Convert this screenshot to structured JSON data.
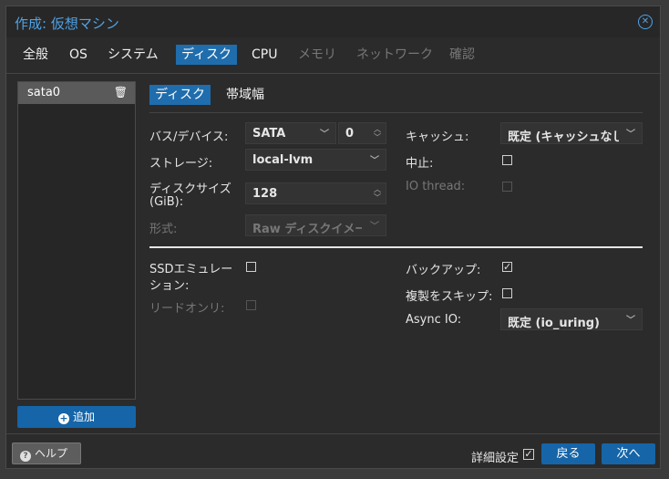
{
  "dialog": {
    "title": "作成: 仮想マシン",
    "close_icon": "close-circle-icon"
  },
  "tabs": [
    {
      "label": "全般",
      "state": "normal"
    },
    {
      "label": "OS",
      "state": "normal"
    },
    {
      "label": "システム",
      "state": "normal"
    },
    {
      "label": "ディスク",
      "state": "active"
    },
    {
      "label": "CPU",
      "state": "normal"
    },
    {
      "label": "メモリ",
      "state": "disabled"
    },
    {
      "label": "ネットワーク",
      "state": "disabled"
    },
    {
      "label": "確認",
      "state": "disabled"
    }
  ],
  "sidebar": {
    "items": [
      {
        "label": "sata0",
        "icon": "trash-icon"
      }
    ],
    "add_label": "追加"
  },
  "subtabs": [
    {
      "label": "ディスク",
      "state": "active"
    },
    {
      "label": "帯域幅",
      "state": "normal"
    }
  ],
  "form": {
    "bus_label": "バス/デバイス:",
    "bus_value": "SATA",
    "bus_index": "0",
    "storage_label": "ストレージ:",
    "storage_value": "local-lvm",
    "size_label_1": "ディスクサイズ",
    "size_label_2": "(GiB):",
    "size_value": "128",
    "format_label": "形式:",
    "format_value": "Raw ディスクイメー",
    "cache_label": "キャッシュ:",
    "cache_value": "既定 (キャッシュなし",
    "discard_label": "中止:",
    "discard_checked": false,
    "iothread_label": "IO thread:",
    "iothread_checked": false,
    "ssd_label_1": "SSDエミュレー",
    "ssd_label_2": "ション:",
    "ssd_checked": false,
    "readonly_label": "リードオンリ:",
    "readonly_checked": false,
    "backup_label": "バックアップ:",
    "backup_checked": true,
    "skip_replication_label": "複製をスキップ:",
    "skip_replication_checked": false,
    "async_io_label": "Async IO:",
    "async_io_value": "既定 (io_uring)"
  },
  "footer": {
    "help_label": "ヘルプ",
    "advanced_label": "詳細設定",
    "advanced_checked": true,
    "back_label": "戻る",
    "next_label": "次へ"
  },
  "colors": {
    "accent": "#1f6dad",
    "title": "#4fa3e6",
    "background": "#2b2b2b"
  }
}
